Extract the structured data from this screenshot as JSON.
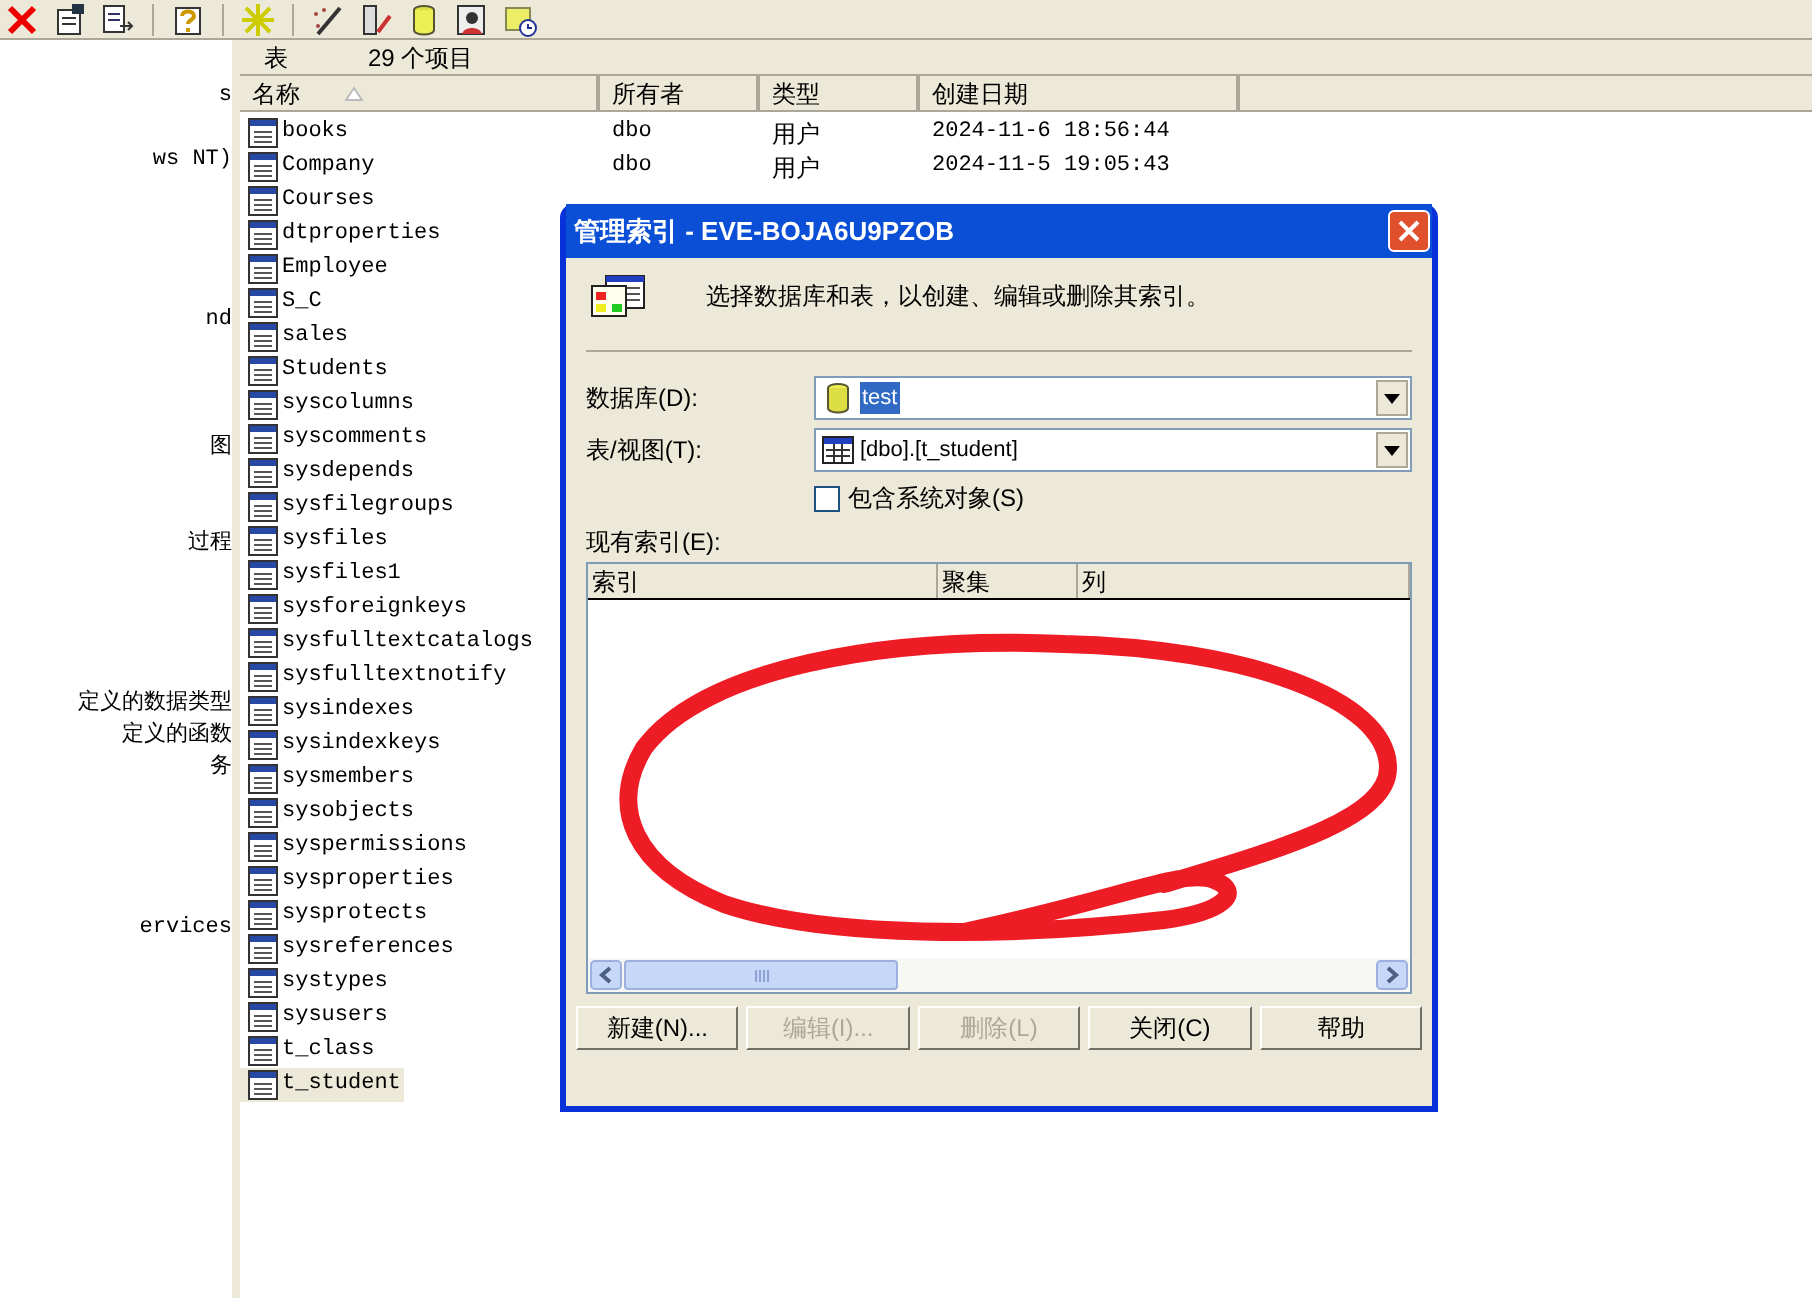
{
  "tree": {
    "items": [
      "s",
      "ws NT)",
      "nd",
      "图",
      "过程",
      "定义的数据类型",
      "定义的函数",
      "务",
      "ervices"
    ]
  },
  "list_header": {
    "label": "表",
    "count": "29 个项目"
  },
  "table": {
    "columns": [
      "名称",
      "所有者",
      "类型",
      "创建日期"
    ],
    "rows": [
      {
        "name": "books",
        "owner": "dbo",
        "type": "用户",
        "created": "2024-11-6 18:56:44",
        "selected": false
      },
      {
        "name": "Company",
        "owner": "dbo",
        "type": "用户",
        "created": "2024-11-5 19:05:43",
        "selected": false
      },
      {
        "name": "Courses",
        "selected": false
      },
      {
        "name": "dtproperties",
        "selected": false
      },
      {
        "name": "Employee",
        "selected": false
      },
      {
        "name": "S_C",
        "selected": false
      },
      {
        "name": "sales",
        "selected": false
      },
      {
        "name": "Students",
        "selected": false
      },
      {
        "name": "syscolumns",
        "selected": false
      },
      {
        "name": "syscomments",
        "selected": false
      },
      {
        "name": "sysdepends",
        "selected": false
      },
      {
        "name": "sysfilegroups",
        "selected": false
      },
      {
        "name": "sysfiles",
        "selected": false
      },
      {
        "name": "sysfiles1",
        "selected": false
      },
      {
        "name": "sysforeignkeys",
        "selected": false
      },
      {
        "name": "sysfulltextcatalogs",
        "selected": false
      },
      {
        "name": "sysfulltextnotify",
        "selected": false
      },
      {
        "name": "sysindexes",
        "selected": false
      },
      {
        "name": "sysindexkeys",
        "selected": false
      },
      {
        "name": "sysmembers",
        "selected": false
      },
      {
        "name": "sysobjects",
        "selected": false
      },
      {
        "name": "syspermissions",
        "selected": false
      },
      {
        "name": "sysproperties",
        "selected": false
      },
      {
        "name": "sysprotects",
        "selected": false
      },
      {
        "name": "sysreferences",
        "selected": false
      },
      {
        "name": "systypes",
        "selected": false
      },
      {
        "name": "sysusers",
        "selected": false
      },
      {
        "name": "t_class",
        "selected": false
      },
      {
        "name": "t_student",
        "selected": true
      }
    ]
  },
  "dialog": {
    "title": "管理索引 - EVE-BOJA6U9PZOB",
    "description": "选择数据库和表，以创建、编辑或删除其索引。",
    "database": {
      "label": "数据库(D):",
      "value": "test"
    },
    "table_view": {
      "label": "表/视图(T):",
      "value": "[dbo].[t_student]"
    },
    "include_system": {
      "label": "包含系统对象(S)",
      "checked": false
    },
    "index_list": {
      "label": "现有索引(E):",
      "columns": [
        "索引",
        "聚集",
        "列"
      ]
    },
    "buttons": [
      {
        "label": "新建(N)...",
        "disabled": false
      },
      {
        "label": "编辑(I)...",
        "disabled": true
      },
      {
        "label": "删除(L)",
        "disabled": true
      },
      {
        "label": "关闭(C)",
        "disabled": false
      },
      {
        "label": "帮助",
        "disabled": false
      }
    ]
  }
}
